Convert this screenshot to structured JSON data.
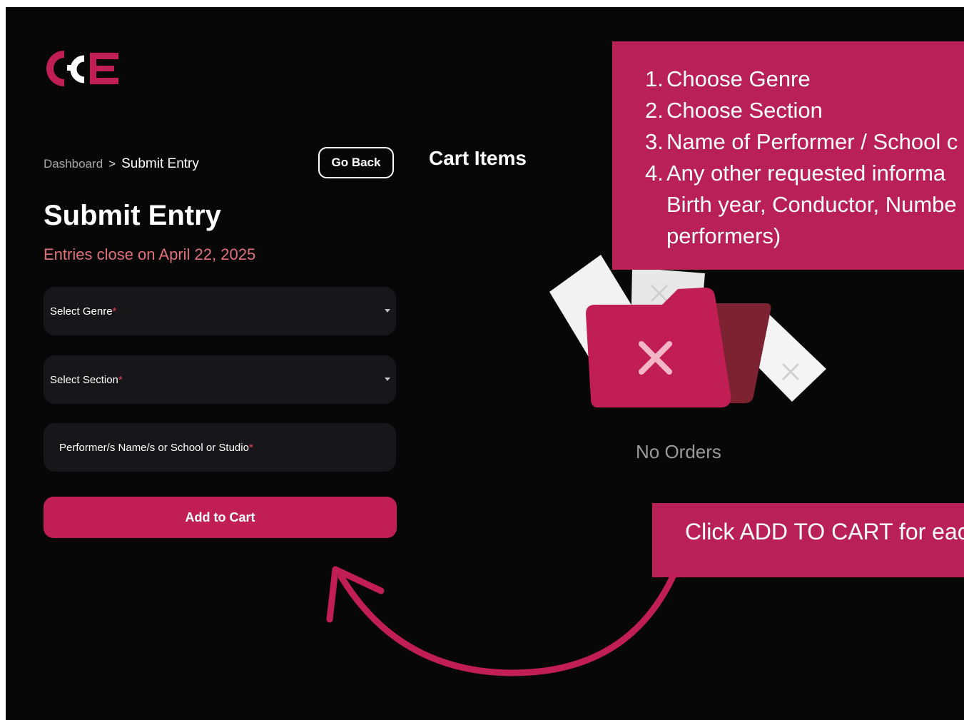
{
  "colors": {
    "background": "#070707",
    "accent": "#c01e55",
    "overlay": "#b92055",
    "deadline_text": "#e0707a",
    "field_bg": "#17171a"
  },
  "logo": {
    "text": "GCE"
  },
  "breadcrumb": {
    "parent": "Dashboard",
    "separator": ">",
    "current": "Submit Entry"
  },
  "header": {
    "go_back_label": "Go Back"
  },
  "form": {
    "title": "Submit Entry",
    "deadline_text": "Entries close on April 22, 2025",
    "genre": {
      "label": "Select Genre",
      "required_mark": "*"
    },
    "section": {
      "label": "Select Section",
      "required_mark": "*"
    },
    "performer": {
      "label": "Performer/s Name/s or School or Studio",
      "required_mark": "*"
    },
    "add_to_cart_label": "Add to Cart"
  },
  "cart": {
    "title": "Cart Items",
    "empty_text": "No Orders",
    "empty_icon": "empty-folder-icon"
  },
  "tutorial": {
    "steps": [
      {
        "num": "1.",
        "text": "Choose Genre"
      },
      {
        "num": "2.",
        "text": "Choose Section"
      },
      {
        "num": "3.",
        "text": "Name of Performer / School c"
      },
      {
        "num": "4.",
        "text": " Any other requested informa"
      }
    ],
    "step4_continuation": [
      "Birth year, Conductor, Numbe",
      "performers)"
    ],
    "cart_hint": "Click ADD TO CART for eac"
  }
}
